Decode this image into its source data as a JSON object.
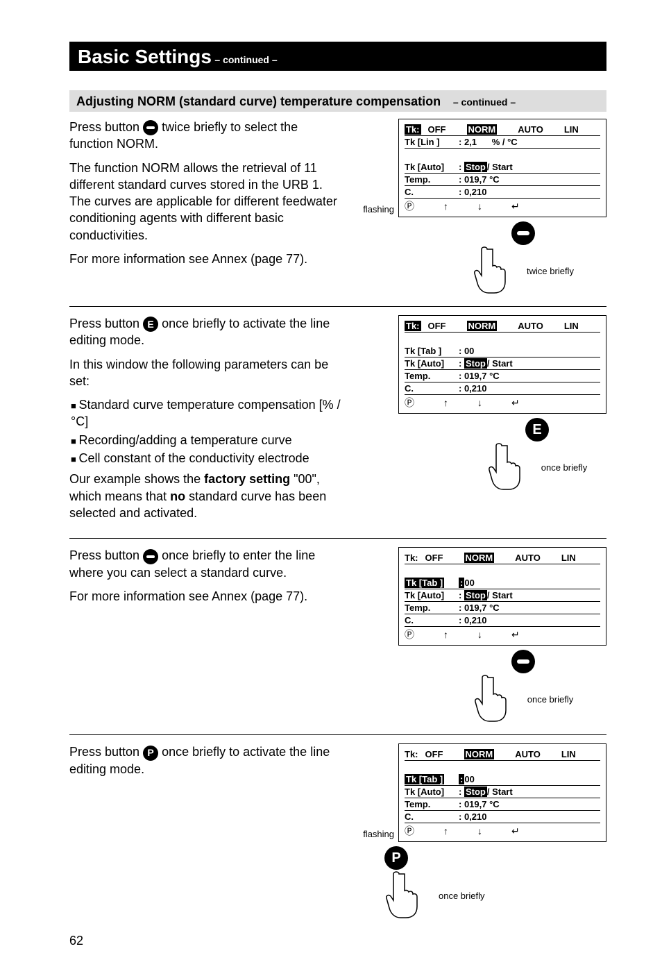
{
  "title": {
    "main": "Basic Settings",
    "sub": "– continued –"
  },
  "section": {
    "heading": "Adjusting NORM (standard curve) temperature compensation",
    "sub": "– continued –"
  },
  "block1": {
    "para1_a": "Press button ",
    "para1_b": " twice briefly to select the function NORM.",
    "para2": "The function NORM allows the retrieval of 11 different standard curves stored in the URB 1. The curves are applicable for different feedwater conditioning agents with different basic conductivities.",
    "para3": "For more information see Annex (page 77).",
    "flashing": "flashing",
    "hand_caption": "twice briefly",
    "lcd": {
      "tabs": {
        "tk_pre": "Tk:",
        "off": "OFF",
        "norm": "NORM",
        "auto": "AUTO",
        "lin": "LIN"
      },
      "r1": {
        "k": "Tk [Lin ]",
        "v1": ": 2,1",
        "v2": "% / °C"
      },
      "gap": "",
      "r2": {
        "k": "Tk [Auto]",
        "stop": "Stop",
        "start": "/ Start"
      },
      "r3": {
        "k": "Temp.",
        "v": ": 019,7 °C"
      },
      "r4": {
        "k": "C.",
        "v": ": 0,210"
      },
      "nav": {
        "p": "Ⓟ",
        "up": "↑",
        "down": "↓",
        "enter": "↵"
      }
    }
  },
  "block2": {
    "para1_a": "Press button ",
    "para1_b": " once briefly to activate the line editing mode.",
    "para2": "In this window the following parameters can be set:",
    "bullets": [
      "Standard curve temperature compensation [% / °C]",
      "Recording/adding a temperature curve",
      "Cell constant of the conductivity electrode"
    ],
    "para3_a": "Our example shows the ",
    "para3_b": "factory setting",
    "para3_c": "  \"00\", which means that ",
    "para3_d": "no",
    "para3_e": " standard curve has been selected and activated.",
    "hand_caption": "once briefly",
    "hand_letter": "E",
    "lcd": {
      "tabs": {
        "tk_pre": "Tk:",
        "off": "OFF",
        "norm": "NORM",
        "auto": "AUTO",
        "lin": "LIN"
      },
      "gap": "",
      "r1": {
        "k": "Tk [Tab ]",
        "v": ": 00"
      },
      "r2": {
        "k": "Tk [Auto]",
        "stop": "Stop",
        "start": "/ Start"
      },
      "r3": {
        "k": "Temp.",
        "v": ": 019,7 °C"
      },
      "r4": {
        "k": "C.",
        "v": ": 0,210"
      },
      "nav": {
        "p": "Ⓟ",
        "up": "↑",
        "down": "↓",
        "enter": "↵"
      }
    }
  },
  "block3": {
    "para1_a": "Press button ",
    "para1_b": " once briefly to enter the line where you can select a standard curve.",
    "para2": "For more information see Annex (page 77).",
    "hand_caption": "once briefly",
    "lcd": {
      "tabs": {
        "tk": "Tk:",
        "off": "OFF",
        "norm": "NORM",
        "auto": "AUTO",
        "lin": "LIN"
      },
      "gap": "",
      "r1": {
        "k": "Tk [Tab ]",
        "pre": ": ",
        "v": "00"
      },
      "r2": {
        "k": "Tk [Auto]",
        "stop": "Stop",
        "start": "/ Start"
      },
      "r3": {
        "k": "Temp.",
        "v": ": 019,7 °C"
      },
      "r4": {
        "k": "C.",
        "v": ": 0,210"
      },
      "nav": {
        "p": "Ⓟ",
        "up": "↑",
        "down": "↓",
        "enter": "↵"
      }
    }
  },
  "block4": {
    "para1_a": "Press button ",
    "para1_b": " once briefly to activate the line editing mode.",
    "flashing": "flashing",
    "hand_caption": "once briefly",
    "hand_letter": "P",
    "lcd": {
      "tabs": {
        "tk": "Tk:",
        "off": "OFF",
        "norm": "NORM",
        "auto": "AUTO",
        "lin": "LIN"
      },
      "gap": "",
      "r1": {
        "k": "Tk [Tab ]",
        "pre": ": ",
        "v": "00"
      },
      "r2": {
        "k": "Tk [Auto]",
        "stop": "Stop",
        "start": "/ Start"
      },
      "r3": {
        "k": "Temp.",
        "v": ": 019,7 °C"
      },
      "r4": {
        "k": "C.",
        "v": ": 0,210"
      },
      "nav": {
        "p": "Ⓟ",
        "up": "↑",
        "down": "↓",
        "enter": "↵"
      }
    }
  },
  "page_number": "62"
}
